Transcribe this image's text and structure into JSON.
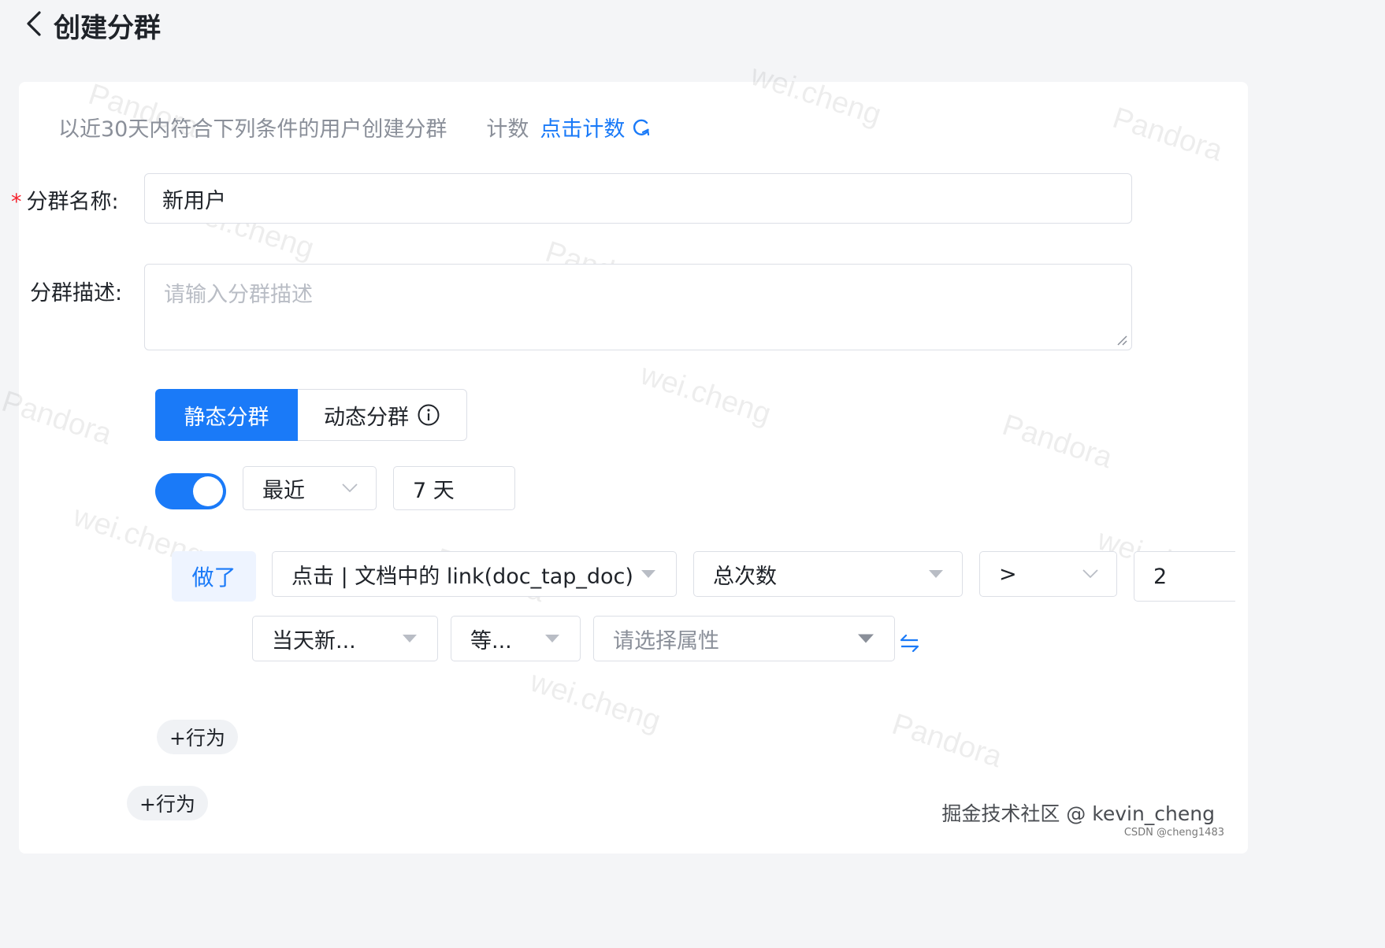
{
  "header": {
    "title": "创建分群"
  },
  "hint": {
    "text": "以近30天内符合下列条件的用户创建分群",
    "count_label": "计数",
    "count_link": "点击计数"
  },
  "form": {
    "name_label": "分群名称:",
    "name_value": "新用户",
    "desc_label": "分群描述:",
    "desc_placeholder": "请输入分群描述"
  },
  "segment_type": {
    "options": [
      "静态分群",
      "动态分群"
    ],
    "active": "静态分群"
  },
  "time_filter": {
    "enabled": true,
    "mode": "最近",
    "range": "7 天"
  },
  "condition": {
    "did_label": "做了",
    "event": "点击 | 文档中的 link(doc_tap_doc)",
    "metric": "总次数",
    "operator": ">",
    "value": "2"
  },
  "sub_condition": {
    "field": "当天新...",
    "operator": "等...",
    "attribute_placeholder": "请选择属性"
  },
  "actions": {
    "add_behavior_inner": "+行为",
    "add_behavior_outer": "+行为"
  },
  "watermarks": {
    "name": "wei.cheng",
    "brand": "Pandora"
  },
  "footer": {
    "credit": "掘金技术社区 @ kevin_cheng",
    "sub": "CSDN @cheng1483"
  }
}
